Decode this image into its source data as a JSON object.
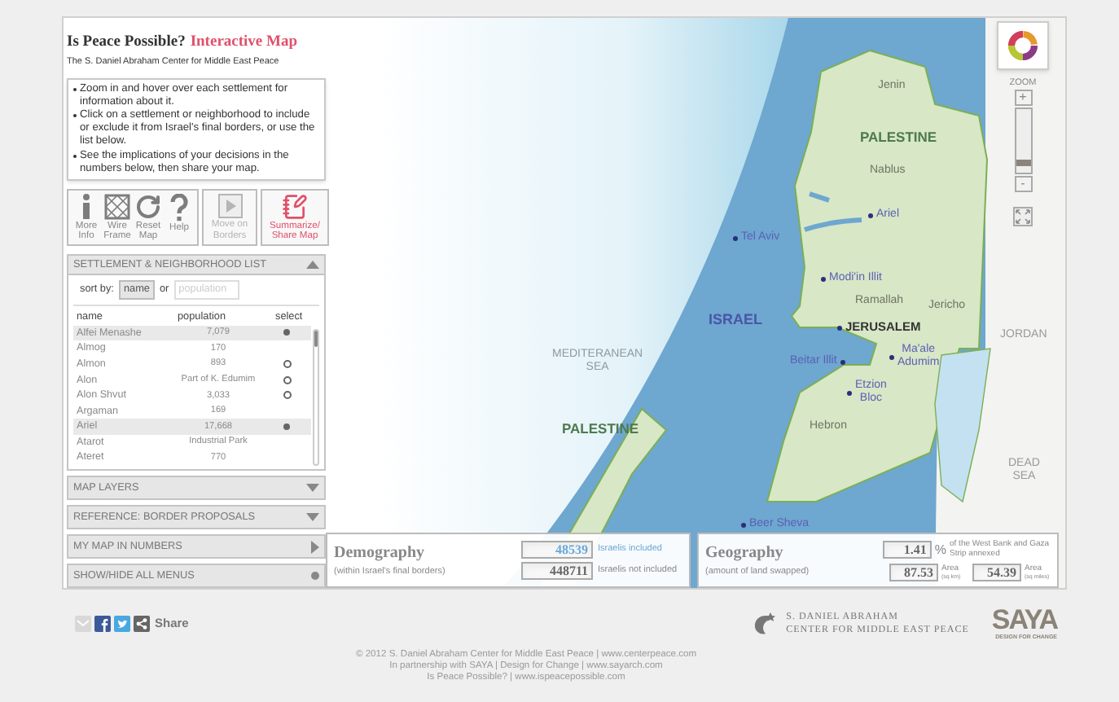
{
  "header": {
    "title": "Is Peace Possible?",
    "title_highlight": "Interactive Map",
    "subtitle": "The S. Daniel Abraham Center for Middle East Peace"
  },
  "instructions": [
    "Zoom in and hover over each settlement for information about it.",
    "Click on a settlement or neighborhood to include or exclude it from Israel's final borders, or use the list below.",
    "See the implications of your decisions in the numbers below, then share your map."
  ],
  "toolbar": [
    [
      {
        "label": "More Info",
        "kind": "info",
        "disabled": false,
        "highlighted": false
      },
      {
        "label": "Wire Frame",
        "kind": "wireframe",
        "disabled": false,
        "highlighted": false
      },
      {
        "label": "Reset Map",
        "kind": "reset",
        "disabled": false,
        "highlighted": false
      },
      {
        "label": "Help",
        "kind": "help",
        "disabled": false,
        "highlighted": false
      }
    ],
    [
      {
        "label": "Move on Borders",
        "kind": "play",
        "disabled": true,
        "highlighted": false
      }
    ],
    [
      {
        "label": "Summarize/ Share Map",
        "kind": "share",
        "disabled": false,
        "highlighted": true
      }
    ]
  ],
  "settlement_list": {
    "title": "SETTLEMENT & NEIGHBORHOOD LIST",
    "expanded": true,
    "sort_label": "sort by:",
    "sort_or": "or",
    "sort_options": [
      {
        "label": "name",
        "selected": true
      },
      {
        "label": "population",
        "selected": false
      }
    ],
    "columns": [
      "name",
      "population",
      "select"
    ],
    "rows": [
      {
        "name": "Alfei Menashe",
        "population": "7,079",
        "selected": true,
        "included": true
      },
      {
        "name": "Almog",
        "population": "170",
        "selected": false
      },
      {
        "name": "Almon",
        "population": "893",
        "selected": false,
        "included": false
      },
      {
        "name": "Alon",
        "population": "Part of K. Edumim",
        "selected": false,
        "included": false
      },
      {
        "name": "Alon Shvut",
        "population": "3,033",
        "selected": false,
        "included": false
      },
      {
        "name": "Argaman",
        "population": "169",
        "selected": false
      },
      {
        "name": "Ariel",
        "population": "17,668",
        "selected": true,
        "included": true
      },
      {
        "name": "Atarot",
        "population": "Industrial Park",
        "selected": false
      },
      {
        "name": "Ateret",
        "population": "770",
        "selected": false
      }
    ]
  },
  "menus": [
    {
      "label": "MAP LAYERS",
      "kind": "dropdown"
    },
    {
      "label": "REFERENCE: BORDER PROPOSALS",
      "kind": "dropdown"
    },
    {
      "label": "MY MAP IN NUMBERS",
      "kind": "panel"
    },
    {
      "label": "SHOW/HIDE ALL MENUS",
      "kind": "toggle"
    }
  ],
  "zoom": {
    "label": "ZOOM",
    "zoom_in": "+",
    "zoom_out": "-",
    "level": 0.15
  },
  "map": {
    "labels": [
      {
        "text": "Jenin",
        "kind": "town"
      },
      {
        "text": "PALESTINE",
        "kind": "territory"
      },
      {
        "text": "Nablus",
        "kind": "town"
      },
      {
        "text": "Ariel",
        "kind": "settlement"
      },
      {
        "text": "Tel Aviv",
        "kind": "settlement"
      },
      {
        "text": "Modi'in Illit",
        "kind": "settlement"
      },
      {
        "text": "Ramallah",
        "kind": "town"
      },
      {
        "text": "Jericho",
        "kind": "town"
      },
      {
        "text": "ISRAEL",
        "kind": "state"
      },
      {
        "text": "JERUSALEM",
        "kind": "capital"
      },
      {
        "text": "Beitar Illit",
        "kind": "settlement"
      },
      {
        "text": "Ma'ale Adumim",
        "kind": "settlement"
      },
      {
        "text": "Etzion Bloc",
        "kind": "settlement"
      },
      {
        "text": "Hebron",
        "kind": "town"
      },
      {
        "text": "MEDITERANEAN SEA",
        "kind": "sea"
      },
      {
        "text": "PALESTINE",
        "kind": "territory"
      },
      {
        "text": "JORDAN",
        "kind": "neighbor"
      },
      {
        "text": "DEAD SEA",
        "kind": "neighbor"
      },
      {
        "text": "Beer Sheva",
        "kind": "settlement"
      }
    ]
  },
  "demography": {
    "title": "Demography",
    "subtitle": "(within Israel's final borders)",
    "rows": [
      {
        "value": "48539",
        "label": "Israelis included",
        "highlighted": true
      },
      {
        "value": "448711",
        "label": "Israelis not included",
        "highlighted": false
      }
    ]
  },
  "geography": {
    "title": "Geography",
    "subtitle": "(amount of land swapped)",
    "annexed": {
      "value": "1.41",
      "unit": "%",
      "label": "of the West Bank and Gaza Strip annexed"
    },
    "areas": [
      {
        "value": "87.53",
        "label": "Area",
        "unit": "(sq km)"
      },
      {
        "value": "54.39",
        "label": "Area",
        "unit": "(sq miles)"
      }
    ]
  },
  "share": {
    "label": "Share"
  },
  "footer": {
    "logo_line1": "S. DANIEL ABRAHAM",
    "logo_line2": "CENTER FOR MIDDLE EAST PEACE",
    "saya": "SAYA",
    "saya_tagline": "DESIGN FOR CHANGE",
    "lines": [
      "© 2012 S. Daniel Abraham Center for Middle East Peace | www.centerpeace.com",
      "In partnership with SAYA | Design for Change | www.sayarch.com",
      "Is Peace Possible? | www.ispeacepossible.com"
    ]
  }
}
